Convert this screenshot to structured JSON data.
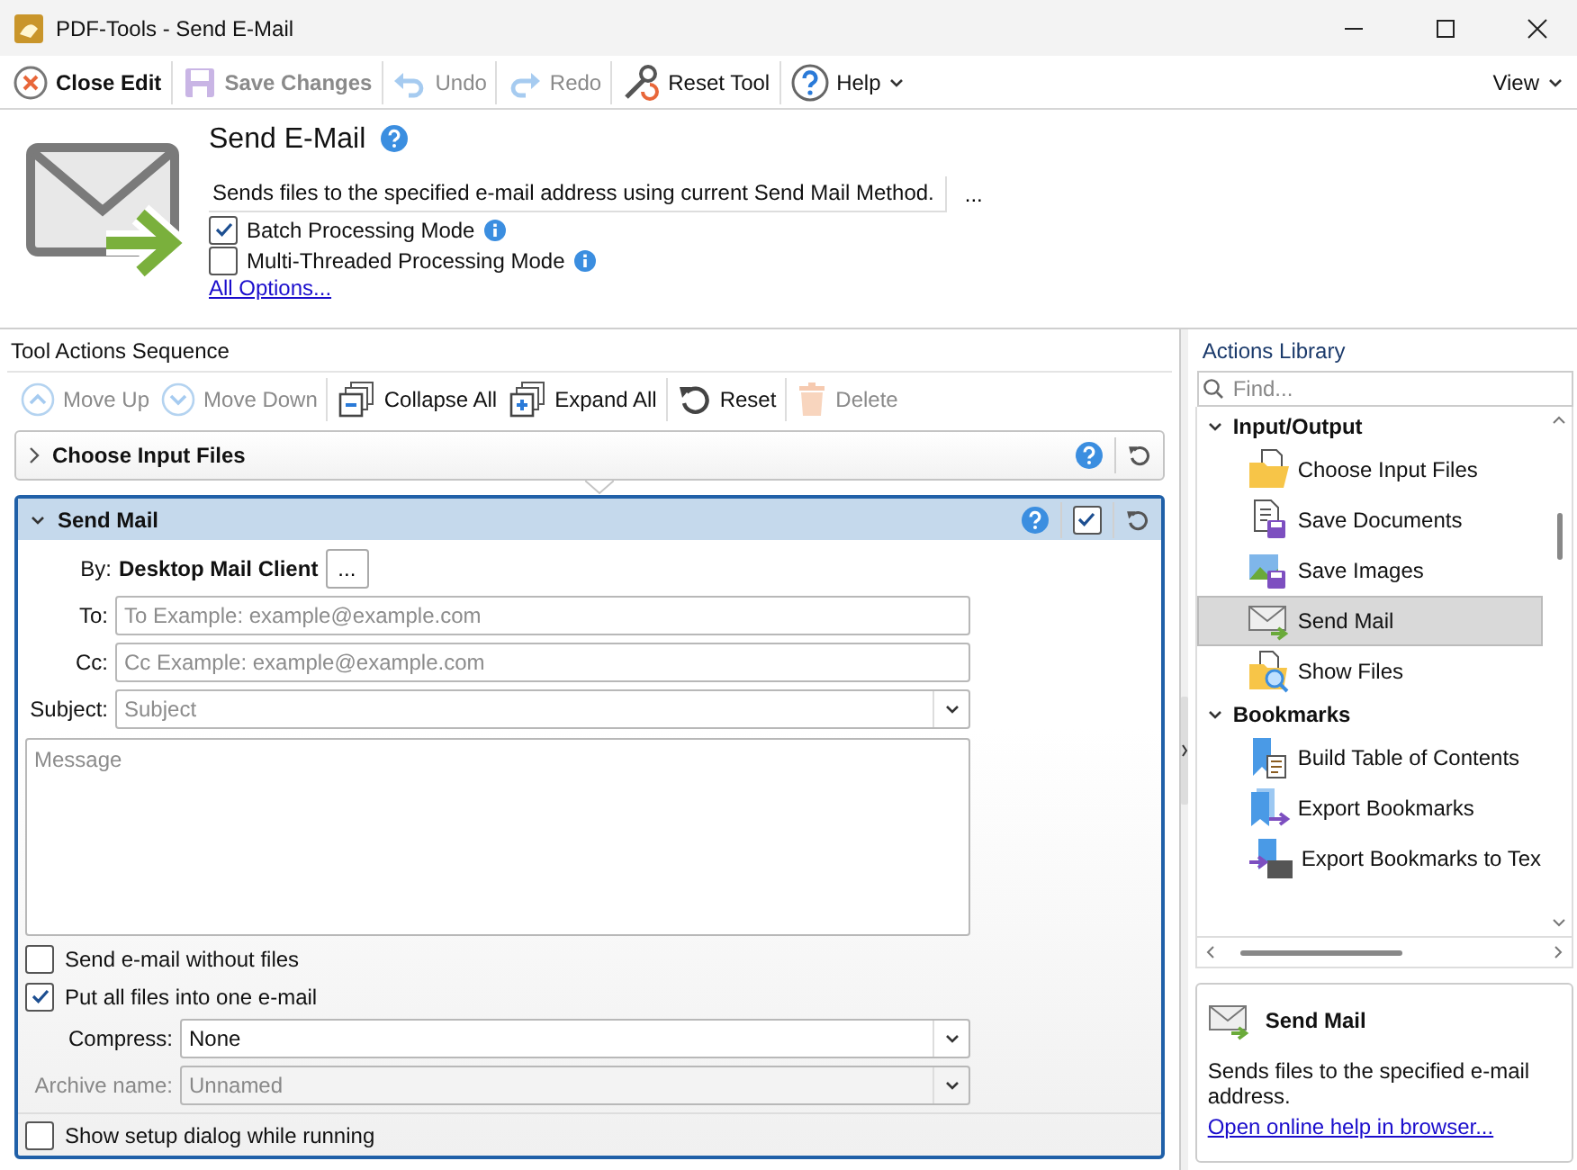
{
  "window": {
    "title": "PDF-Tools - Send E-Mail"
  },
  "toolbar": {
    "items": [
      {
        "label": "Close Edit",
        "kind": "close",
        "disabled": false,
        "dropdown": false
      },
      {
        "label": "Save Changes",
        "kind": "save",
        "disabled": true,
        "dropdown": false
      },
      {
        "label": "Undo",
        "kind": "undo",
        "disabled": true,
        "dropdown": false
      },
      {
        "label": "Redo",
        "kind": "redo",
        "disabled": true,
        "dropdown": false
      },
      {
        "label": "Reset Tool",
        "kind": "reset",
        "disabled": false,
        "dropdown": false
      },
      {
        "label": "Help",
        "kind": "help",
        "disabled": false,
        "dropdown": true
      }
    ],
    "view_menu": "View"
  },
  "tool": {
    "title": "Send E-Mail",
    "description": "Sends files to the specified e-mail address using current Send Mail Method.",
    "more_button": "...",
    "options": [
      {
        "label": "Batch Processing Mode",
        "checked": true
      },
      {
        "label": "Multi-Threaded Processing Mode",
        "checked": false
      }
    ],
    "all_options_link": "All Options..."
  },
  "sequence": {
    "title": "Tool Actions Sequence",
    "toolbar": [
      {
        "label": "Move Up",
        "kind": "up",
        "disabled": true
      },
      {
        "label": "Move Down",
        "kind": "down",
        "disabled": true
      },
      {
        "label": "Collapse All",
        "kind": "collapse",
        "disabled": false
      },
      {
        "label": "Expand All",
        "kind": "expand",
        "disabled": false
      },
      {
        "label": "Reset",
        "kind": "reset",
        "disabled": false
      },
      {
        "label": "Delete",
        "kind": "delete",
        "disabled": true
      }
    ],
    "actions": [
      {
        "title": "Choose Input Files",
        "expanded": false
      },
      {
        "title": "Send Mail",
        "expanded": true,
        "enabled": true
      }
    ],
    "form": {
      "by_label": "By:",
      "by_value": "Desktop Mail Client",
      "by_button": "...",
      "fields": [
        {
          "label": "To:",
          "placeholder": "To Example: example@example.com",
          "kind": "text"
        },
        {
          "label": "Cc:",
          "placeholder": "Cc Example: example@example.com",
          "kind": "text"
        },
        {
          "label": "Subject:",
          "placeholder": "Subject",
          "kind": "combo"
        }
      ],
      "message_placeholder": "Message",
      "checks": [
        {
          "label": "Send e-mail without files",
          "checked": false
        },
        {
          "label": "Put all files into one e-mail",
          "checked": true
        }
      ],
      "compress": {
        "label": "Compress:",
        "value": "None",
        "disabled": false
      },
      "archive_name": {
        "label": "Archive name:",
        "value": "Unnamed",
        "disabled": true
      },
      "show_setup": {
        "label": "Show setup dialog while running",
        "checked": false
      }
    }
  },
  "library": {
    "title": "Actions Library",
    "search": {
      "placeholder": "Find..."
    },
    "groups": [
      {
        "label": "Input/Output",
        "expanded": true,
        "children": [
          {
            "label": "Choose Input Files",
            "kind": "folder",
            "selected": false
          },
          {
            "label": "Save Documents",
            "kind": "save-doc",
            "selected": false
          },
          {
            "label": "Save Images",
            "kind": "save-image",
            "selected": false
          },
          {
            "label": "Send Mail",
            "kind": "mail",
            "selected": true
          },
          {
            "label": "Show Files",
            "kind": "show",
            "selected": false
          }
        ]
      },
      {
        "label": "Bookmarks",
        "expanded": true,
        "children": [
          {
            "label": "Build Table of Contents",
            "kind": "bookmark",
            "selected": false
          },
          {
            "label": "Export Bookmarks",
            "kind": "bookmark-export",
            "selected": false
          },
          {
            "label": "Export Bookmarks to Tex",
            "kind": "bookmark-text",
            "selected": false
          }
        ]
      }
    ]
  },
  "info": {
    "title": "Send Mail",
    "description": "Sends files to the specified e-mail address.",
    "link": "Open online help in browser..."
  }
}
